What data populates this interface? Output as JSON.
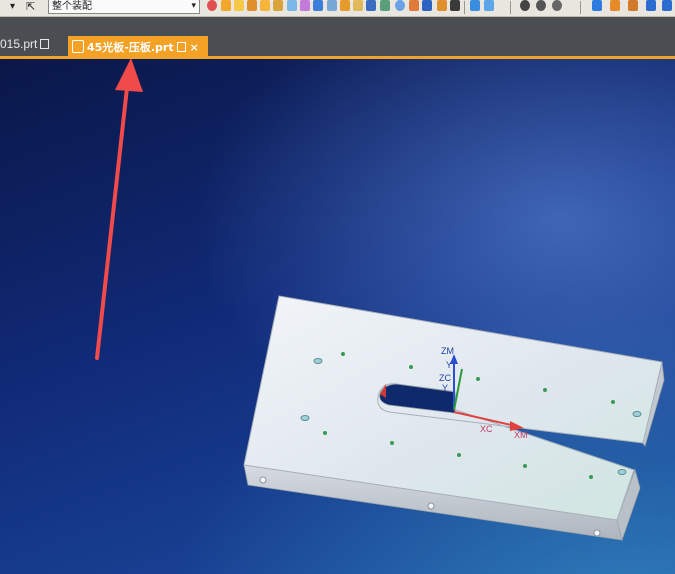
{
  "toolbar": {
    "dropdown_arrow": "▾",
    "selection_filter_value": "整个装配",
    "selection_filter_caret": "▾"
  },
  "tabs": [
    {
      "label": "015.prt",
      "active": false
    },
    {
      "label": "45光板-压板.prt",
      "active": true
    }
  ],
  "tab_close_glyph": "×",
  "viewport": {
    "csys_labels": {
      "zm": "ZM",
      "y1": "Y",
      "zc": "ZC",
      "y2": "Y",
      "xc": "XC",
      "xm": "XM"
    }
  },
  "colors": {
    "accent_tab": "#f3a226",
    "annotation_arrow": "#f04a4a",
    "plate_top": "#e7ecf1",
    "plate_side": "#c7ccd3"
  }
}
